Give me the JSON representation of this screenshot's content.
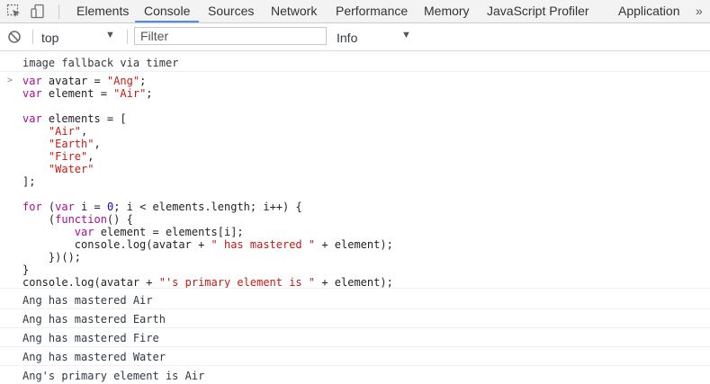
{
  "tabs": [
    "Elements",
    "Console",
    "Sources",
    "Network",
    "Performance",
    "Memory",
    "JavaScript Profiler",
    "Application"
  ],
  "more_label": "»",
  "toolbar": {
    "context_value": "top",
    "filter_placeholder": "Filter",
    "level_value": "Info"
  },
  "console": {
    "first_message": "image fallback via timer",
    "code_lines": [
      "var avatar = \"Ang\";",
      "var element = \"Air\";",
      "",
      "var elements = [",
      "    \"Air\",",
      "    \"Earth\",",
      "    \"Fire\",",
      "    \"Water\"",
      "];",
      "",
      "for (var i = 0; i < elements.length; i++) {",
      "    (function() {",
      "        var element = elements[i];",
      "        console.log(avatar + \" has mastered \" + element);",
      "    })();",
      "}",
      "console.log(avatar + \"'s primary element is \" + element);"
    ],
    "outputs": [
      "Ang has mastered Air",
      "Ang has mastered Earth",
      "Ang has mastered Fire",
      "Ang has mastered Water",
      "Ang's primary element is Air"
    ]
  },
  "colors": {
    "keyword": "#aa0d91",
    "string": "#c41a16",
    "number": "#1c00cf",
    "active_tab": "#4c8df6"
  }
}
